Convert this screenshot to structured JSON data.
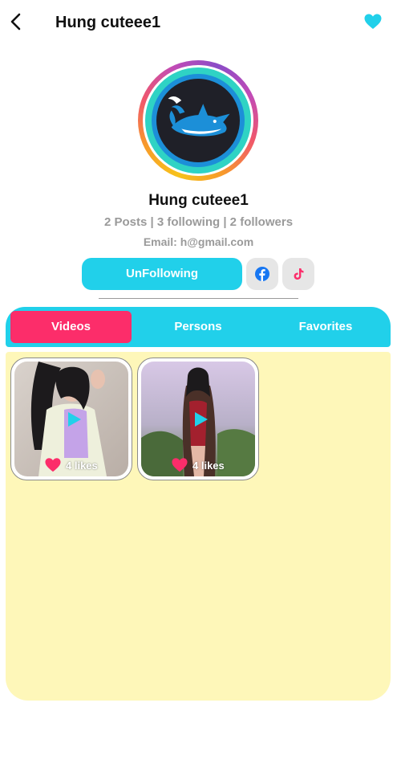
{
  "header": {
    "title": "Hung cuteee1",
    "back_icon": "chevron-left-icon",
    "favorite_icon": "heart-icon"
  },
  "profile": {
    "name": "Hung cuteee1",
    "stats": "2 Posts | 3 following | 2 followers",
    "email": "Email: h@gmail.com"
  },
  "actions": {
    "follow_label": "UnFollowing",
    "facebook_icon": "facebook-icon",
    "tiktok_icon": "tiktok-icon"
  },
  "tabs": [
    {
      "label": "Videos",
      "active": true
    },
    {
      "label": "Persons",
      "active": false
    },
    {
      "label": "Favorites",
      "active": false
    }
  ],
  "videos": [
    {
      "likes": "4 likes"
    },
    {
      "likes": "4 likes"
    }
  ],
  "colors": {
    "accent": "#21d0ea",
    "active_tab": "#fc2d6a",
    "content_bg": "#fef7b9",
    "muted_text": "#9a9a9a"
  }
}
